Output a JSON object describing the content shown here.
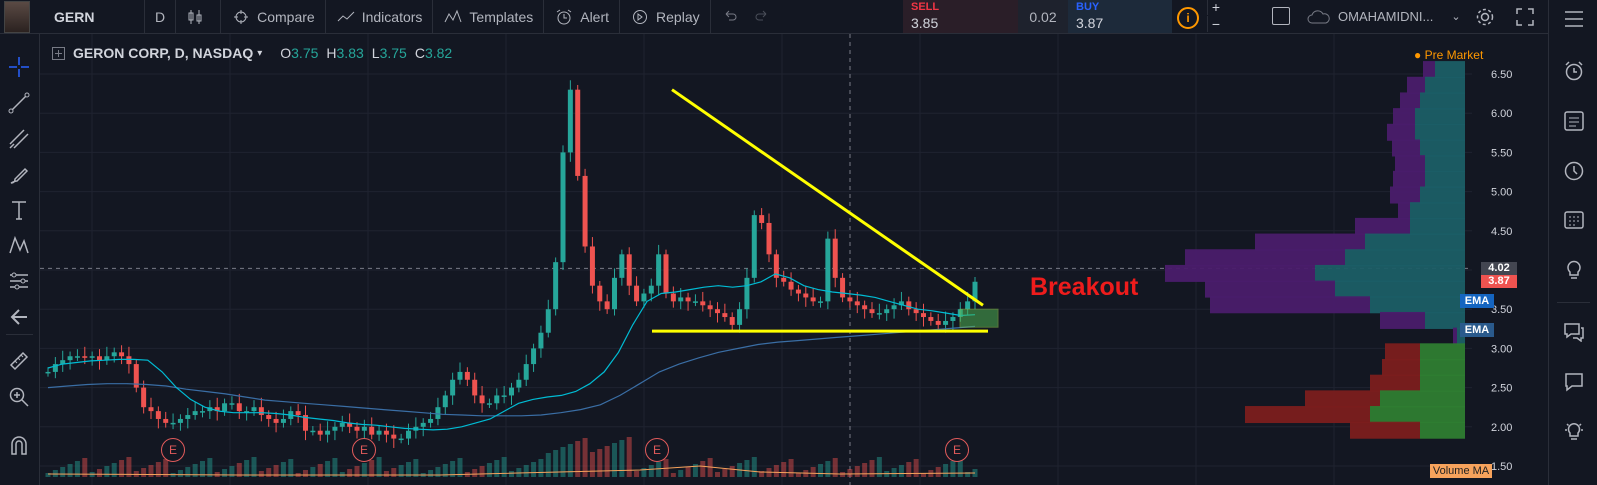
{
  "toolbar": {
    "symbol": "GERN",
    "interval": "D",
    "compare": "Compare",
    "indicators": "Indicators",
    "templates": "Templates",
    "alert": "Alert",
    "replay": "Replay",
    "account": "OMAHAMIDNI..."
  },
  "trade": {
    "sell_label": "SELL",
    "sell_price": "3.85",
    "spread": "0.02",
    "buy_label": "BUY",
    "buy_price": "3.87"
  },
  "legend": {
    "title": "GERON CORP, D, NASDAQ",
    "o_label": "O",
    "o": "3.75",
    "h_label": "H",
    "h": "3.83",
    "l_label": "L",
    "l": "3.75",
    "c_label": "C",
    "c": "3.82"
  },
  "status": {
    "premarket": "Pre Market"
  },
  "annotation": {
    "breakout": "Breakout"
  },
  "tags": {
    "crosshair_price": "4.02",
    "last_price": "3.87",
    "ema1": "EMA",
    "ema2": "EMA",
    "volume_ma": "Volume MA",
    "earnings": "E"
  },
  "colors": {
    "up": "#26a69a",
    "down": "#ef5350",
    "trendline": "#ffff00",
    "breakout": "#ee1c1c",
    "ema_fast": "#00bcd4",
    "ema_slow": "#2962ff"
  },
  "chart_data": {
    "type": "candlestick",
    "title": "GERON CORP, D, NASDAQ",
    "ylim": [
      1.5,
      6.6
    ],
    "yticks": [
      "6.50",
      "6.00",
      "5.50",
      "5.00",
      "4.50",
      "4.00",
      "3.50",
      "3.00",
      "2.50",
      "2.00",
      "1.50"
    ],
    "price_path": [
      2.7,
      2.8,
      2.85,
      2.9,
      2.9,
      2.88,
      2.9,
      2.85,
      2.9,
      2.95,
      2.9,
      2.8,
      2.5,
      2.25,
      2.2,
      2.1,
      2.05,
      2.05,
      2.1,
      2.15,
      2.2,
      2.2,
      2.25,
      2.2,
      2.3,
      2.3,
      2.2,
      2.2,
      2.25,
      2.15,
      2.1,
      2.05,
      2.1,
      2.2,
      2.15,
      1.95,
      1.95,
      1.9,
      1.95,
      2.0,
      2.05,
      2.0,
      1.95,
      2.0,
      1.9,
      1.95,
      1.9,
      1.85,
      1.85,
      1.95,
      2.0,
      2.05,
      2.1,
      2.25,
      2.4,
      2.6,
      2.7,
      2.6,
      2.4,
      2.3,
      2.3,
      2.4,
      2.4,
      2.5,
      2.6,
      2.8,
      3.0,
      3.2,
      3.5,
      4.1,
      5.5,
      6.3,
      5.2,
      4.3,
      3.8,
      3.6,
      3.5,
      3.9,
      4.2,
      3.8,
      3.6,
      3.7,
      3.8,
      4.2,
      3.7,
      3.6,
      3.65,
      3.6,
      3.6,
      3.55,
      3.5,
      3.45,
      3.4,
      3.3,
      3.5,
      3.9,
      4.7,
      4.6,
      4.2,
      3.9,
      3.85,
      3.75,
      3.7,
      3.65,
      3.6,
      3.6,
      4.4,
      3.9,
      3.65,
      3.6,
      3.55,
      3.5,
      3.45,
      3.45,
      3.5,
      3.55,
      3.6,
      3.5,
      3.45,
      3.4,
      3.35,
      3.3,
      3.35,
      3.4,
      3.5,
      3.6,
      3.85
    ],
    "ema_fast": [
      2.75,
      2.8,
      2.82,
      2.84,
      2.85,
      2.86,
      2.86,
      2.85,
      2.7,
      2.5,
      2.35,
      2.25,
      2.2,
      2.18,
      2.18,
      2.18,
      2.17,
      2.15,
      2.12,
      2.1,
      2.08,
      2.05,
      2.03,
      2.02,
      2.0,
      1.98,
      1.97,
      1.96,
      1.97,
      2.0,
      2.05,
      2.1,
      2.2,
      2.3,
      2.35,
      2.38,
      2.4,
      2.45,
      2.55,
      2.7,
      2.95,
      3.3,
      3.6,
      3.7,
      3.72,
      3.75,
      3.78,
      3.8,
      3.78,
      3.8,
      3.85,
      3.95,
      3.9,
      3.8,
      3.75,
      3.72,
      3.7,
      3.68,
      3.65,
      3.6,
      3.55,
      3.5,
      3.48,
      3.45,
      3.42,
      3.43
    ],
    "ema_slow": [
      2.5,
      2.52,
      2.54,
      2.55,
      2.55,
      2.54,
      2.52,
      2.48,
      2.45,
      2.42,
      2.38,
      2.34,
      2.32,
      2.3,
      2.28,
      2.26,
      2.24,
      2.22,
      2.2,
      2.18,
      2.16,
      2.15,
      2.14,
      2.14,
      2.14,
      2.15,
      2.18,
      2.22,
      2.28,
      2.4,
      2.55,
      2.7,
      2.8,
      2.88,
      2.95,
      3.0,
      3.05,
      3.08,
      3.1,
      3.12,
      3.14,
      3.16,
      3.18,
      3.2,
      3.22,
      3.24,
      3.26,
      3.28
    ],
    "volume_profile": [
      {
        "price": 6.55,
        "up": 30,
        "down": 12
      },
      {
        "price": 6.35,
        "up": 40,
        "down": 18
      },
      {
        "price": 6.15,
        "up": 45,
        "down": 20
      },
      {
        "price": 5.95,
        "up": 50,
        "down": 22
      },
      {
        "price": 5.75,
        "up": 50,
        "down": 28
      },
      {
        "price": 5.55,
        "up": 45,
        "down": 28
      },
      {
        "price": 5.35,
        "up": 40,
        "down": 30
      },
      {
        "price": 5.15,
        "up": 40,
        "down": 32
      },
      {
        "price": 4.95,
        "up": 45,
        "down": 30
      },
      {
        "price": 4.75,
        "up": 55,
        "down": 12
      },
      {
        "price": 4.55,
        "up": 55,
        "down": 55
      },
      {
        "price": 4.35,
        "up": 100,
        "down": 110
      },
      {
        "price": 4.15,
        "up": 120,
        "down": 160
      },
      {
        "price": 3.95,
        "up": 150,
        "down": 150
      },
      {
        "price": 3.75,
        "up": 130,
        "down": 130
      },
      {
        "price": 3.55,
        "up": 95,
        "down": 160
      },
      {
        "price": 3.35,
        "up": 40,
        "down": 45
      },
      {
        "price": 3.15,
        "up": 8,
        "down": 4
      },
      {
        "price": 2.95,
        "up": 45,
        "down": 35
      },
      {
        "price": 2.75,
        "up": 45,
        "down": 38
      },
      {
        "price": 2.55,
        "up": 45,
        "down": 50
      },
      {
        "price": 2.35,
        "up": 85,
        "down": 75
      },
      {
        "price": 2.15,
        "up": 95,
        "down": 125
      },
      {
        "price": 1.95,
        "up": 45,
        "down": 70
      }
    ],
    "trendline_desc": {
      "from": 6.3,
      "to": 3.55
    },
    "support_line": 3.22,
    "earnings_markers": 4
  }
}
